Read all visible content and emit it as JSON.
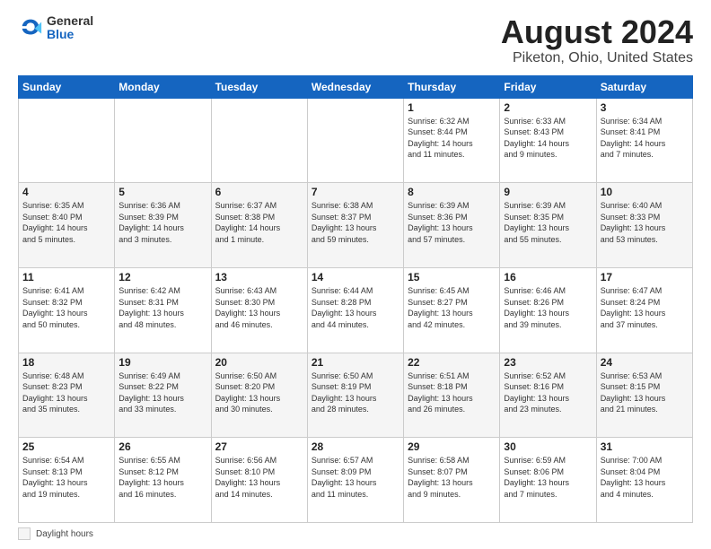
{
  "logo": {
    "general": "General",
    "blue": "Blue"
  },
  "title": "August 2024",
  "subtitle": "Piketon, Ohio, United States",
  "days_of_week": [
    "Sunday",
    "Monday",
    "Tuesday",
    "Wednesday",
    "Thursday",
    "Friday",
    "Saturday"
  ],
  "legend": {
    "label": "Daylight hours"
  },
  "weeks": [
    [
      {
        "num": "",
        "info": ""
      },
      {
        "num": "",
        "info": ""
      },
      {
        "num": "",
        "info": ""
      },
      {
        "num": "",
        "info": ""
      },
      {
        "num": "1",
        "info": "Sunrise: 6:32 AM\nSunset: 8:44 PM\nDaylight: 14 hours\nand 11 minutes."
      },
      {
        "num": "2",
        "info": "Sunrise: 6:33 AM\nSunset: 8:43 PM\nDaylight: 14 hours\nand 9 minutes."
      },
      {
        "num": "3",
        "info": "Sunrise: 6:34 AM\nSunset: 8:41 PM\nDaylight: 14 hours\nand 7 minutes."
      }
    ],
    [
      {
        "num": "4",
        "info": "Sunrise: 6:35 AM\nSunset: 8:40 PM\nDaylight: 14 hours\nand 5 minutes."
      },
      {
        "num": "5",
        "info": "Sunrise: 6:36 AM\nSunset: 8:39 PM\nDaylight: 14 hours\nand 3 minutes."
      },
      {
        "num": "6",
        "info": "Sunrise: 6:37 AM\nSunset: 8:38 PM\nDaylight: 14 hours\nand 1 minute."
      },
      {
        "num": "7",
        "info": "Sunrise: 6:38 AM\nSunset: 8:37 PM\nDaylight: 13 hours\nand 59 minutes."
      },
      {
        "num": "8",
        "info": "Sunrise: 6:39 AM\nSunset: 8:36 PM\nDaylight: 13 hours\nand 57 minutes."
      },
      {
        "num": "9",
        "info": "Sunrise: 6:39 AM\nSunset: 8:35 PM\nDaylight: 13 hours\nand 55 minutes."
      },
      {
        "num": "10",
        "info": "Sunrise: 6:40 AM\nSunset: 8:33 PM\nDaylight: 13 hours\nand 53 minutes."
      }
    ],
    [
      {
        "num": "11",
        "info": "Sunrise: 6:41 AM\nSunset: 8:32 PM\nDaylight: 13 hours\nand 50 minutes."
      },
      {
        "num": "12",
        "info": "Sunrise: 6:42 AM\nSunset: 8:31 PM\nDaylight: 13 hours\nand 48 minutes."
      },
      {
        "num": "13",
        "info": "Sunrise: 6:43 AM\nSunset: 8:30 PM\nDaylight: 13 hours\nand 46 minutes."
      },
      {
        "num": "14",
        "info": "Sunrise: 6:44 AM\nSunset: 8:28 PM\nDaylight: 13 hours\nand 44 minutes."
      },
      {
        "num": "15",
        "info": "Sunrise: 6:45 AM\nSunset: 8:27 PM\nDaylight: 13 hours\nand 42 minutes."
      },
      {
        "num": "16",
        "info": "Sunrise: 6:46 AM\nSunset: 8:26 PM\nDaylight: 13 hours\nand 39 minutes."
      },
      {
        "num": "17",
        "info": "Sunrise: 6:47 AM\nSunset: 8:24 PM\nDaylight: 13 hours\nand 37 minutes."
      }
    ],
    [
      {
        "num": "18",
        "info": "Sunrise: 6:48 AM\nSunset: 8:23 PM\nDaylight: 13 hours\nand 35 minutes."
      },
      {
        "num": "19",
        "info": "Sunrise: 6:49 AM\nSunset: 8:22 PM\nDaylight: 13 hours\nand 33 minutes."
      },
      {
        "num": "20",
        "info": "Sunrise: 6:50 AM\nSunset: 8:20 PM\nDaylight: 13 hours\nand 30 minutes."
      },
      {
        "num": "21",
        "info": "Sunrise: 6:50 AM\nSunset: 8:19 PM\nDaylight: 13 hours\nand 28 minutes."
      },
      {
        "num": "22",
        "info": "Sunrise: 6:51 AM\nSunset: 8:18 PM\nDaylight: 13 hours\nand 26 minutes."
      },
      {
        "num": "23",
        "info": "Sunrise: 6:52 AM\nSunset: 8:16 PM\nDaylight: 13 hours\nand 23 minutes."
      },
      {
        "num": "24",
        "info": "Sunrise: 6:53 AM\nSunset: 8:15 PM\nDaylight: 13 hours\nand 21 minutes."
      }
    ],
    [
      {
        "num": "25",
        "info": "Sunrise: 6:54 AM\nSunset: 8:13 PM\nDaylight: 13 hours\nand 19 minutes."
      },
      {
        "num": "26",
        "info": "Sunrise: 6:55 AM\nSunset: 8:12 PM\nDaylight: 13 hours\nand 16 minutes."
      },
      {
        "num": "27",
        "info": "Sunrise: 6:56 AM\nSunset: 8:10 PM\nDaylight: 13 hours\nand 14 minutes."
      },
      {
        "num": "28",
        "info": "Sunrise: 6:57 AM\nSunset: 8:09 PM\nDaylight: 13 hours\nand 11 minutes."
      },
      {
        "num": "29",
        "info": "Sunrise: 6:58 AM\nSunset: 8:07 PM\nDaylight: 13 hours\nand 9 minutes."
      },
      {
        "num": "30",
        "info": "Sunrise: 6:59 AM\nSunset: 8:06 PM\nDaylight: 13 hours\nand 7 minutes."
      },
      {
        "num": "31",
        "info": "Sunrise: 7:00 AM\nSunset: 8:04 PM\nDaylight: 13 hours\nand 4 minutes."
      }
    ]
  ]
}
